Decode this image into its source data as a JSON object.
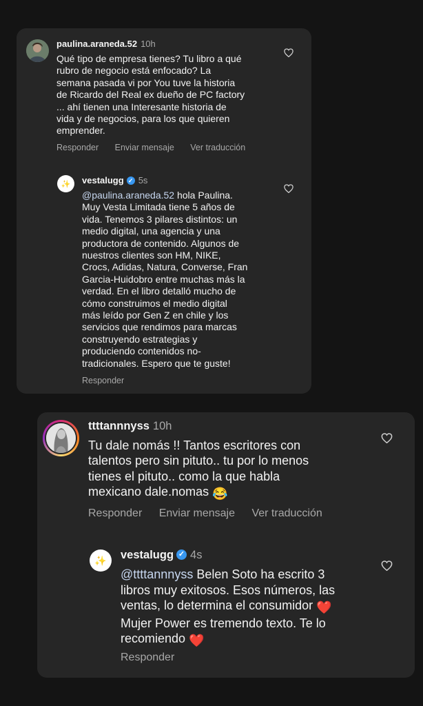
{
  "thread1": {
    "comment": {
      "username": "paulina.araneda.52",
      "time": "10h",
      "text": "Qué tipo de empresa tienes? Tu libro a qué\nrubro de negocio está enfocado? La\nsemana pasada vi por You tuve la historia\nde Ricardo del Real ex dueño de PC factory\n... ahí tienen una Interesante historia  de\nvida y de negocios, para los que quieren\nemprender.",
      "actions": {
        "reply": "Responder",
        "send": "Enviar mensaje",
        "translate": "Ver traducción"
      }
    },
    "reply": {
      "username": "vestalugg",
      "time": "5s",
      "mention": "@paulina.araneda.52",
      "text": " hola Paulina.\nMuy Vesta Limitada tiene 5 años de\nvida. Tenemos 3 pilares distintos: un\nmedio digital, una agencia y una\nproductora de contenido. Algunos de\nnuestros clientes son HM, NIKE,\nCrocs, Adidas, Natura, Converse, Fran\nGarcia-Huidobro entre muchas más la\nverdad. En el libro detalló mucho de\ncómo construimos el medio digital\nmás leído por Gen Z en chile y los\nservicios que rendimos para marcas\nconstruyendo estrategias y\nproduciendo contenidos no-\ntradicionales. Espero que te guste!",
      "actions": {
        "reply": "Responder"
      }
    }
  },
  "thread2": {
    "comment": {
      "username": "ttttannnyss",
      "time": "10h",
      "text": "Tu dale nomás !! Tantos escritores con\ntalentos pero sin pituto.. tu por lo menos\ntienes el pituto.. como la que habla\nmexicano dale.nomas ",
      "emoji": "😂",
      "actions": {
        "reply": "Responder",
        "send": "Enviar mensaje",
        "translate": "Ver traducción"
      }
    },
    "reply": {
      "username": "vestalugg",
      "time": "4s",
      "mention": "@ttttannnyss",
      "text1": " Belen Soto ha escrito 3\nlibros muy exitosos. Esos números, las\nventas, lo determina el consumidor ",
      "text2": "\nMujer Power es tremendo texto. Te lo\nrecomiendo ",
      "emoji": "❤️",
      "actions": {
        "reply": "Responder"
      }
    }
  },
  "icons": {
    "like": "heart-outline-icon",
    "verified": "verified-badge-icon"
  },
  "colors": {
    "background": "#141414",
    "card": "#262626",
    "verified": "#3897f0",
    "heart": "#e8202a"
  }
}
